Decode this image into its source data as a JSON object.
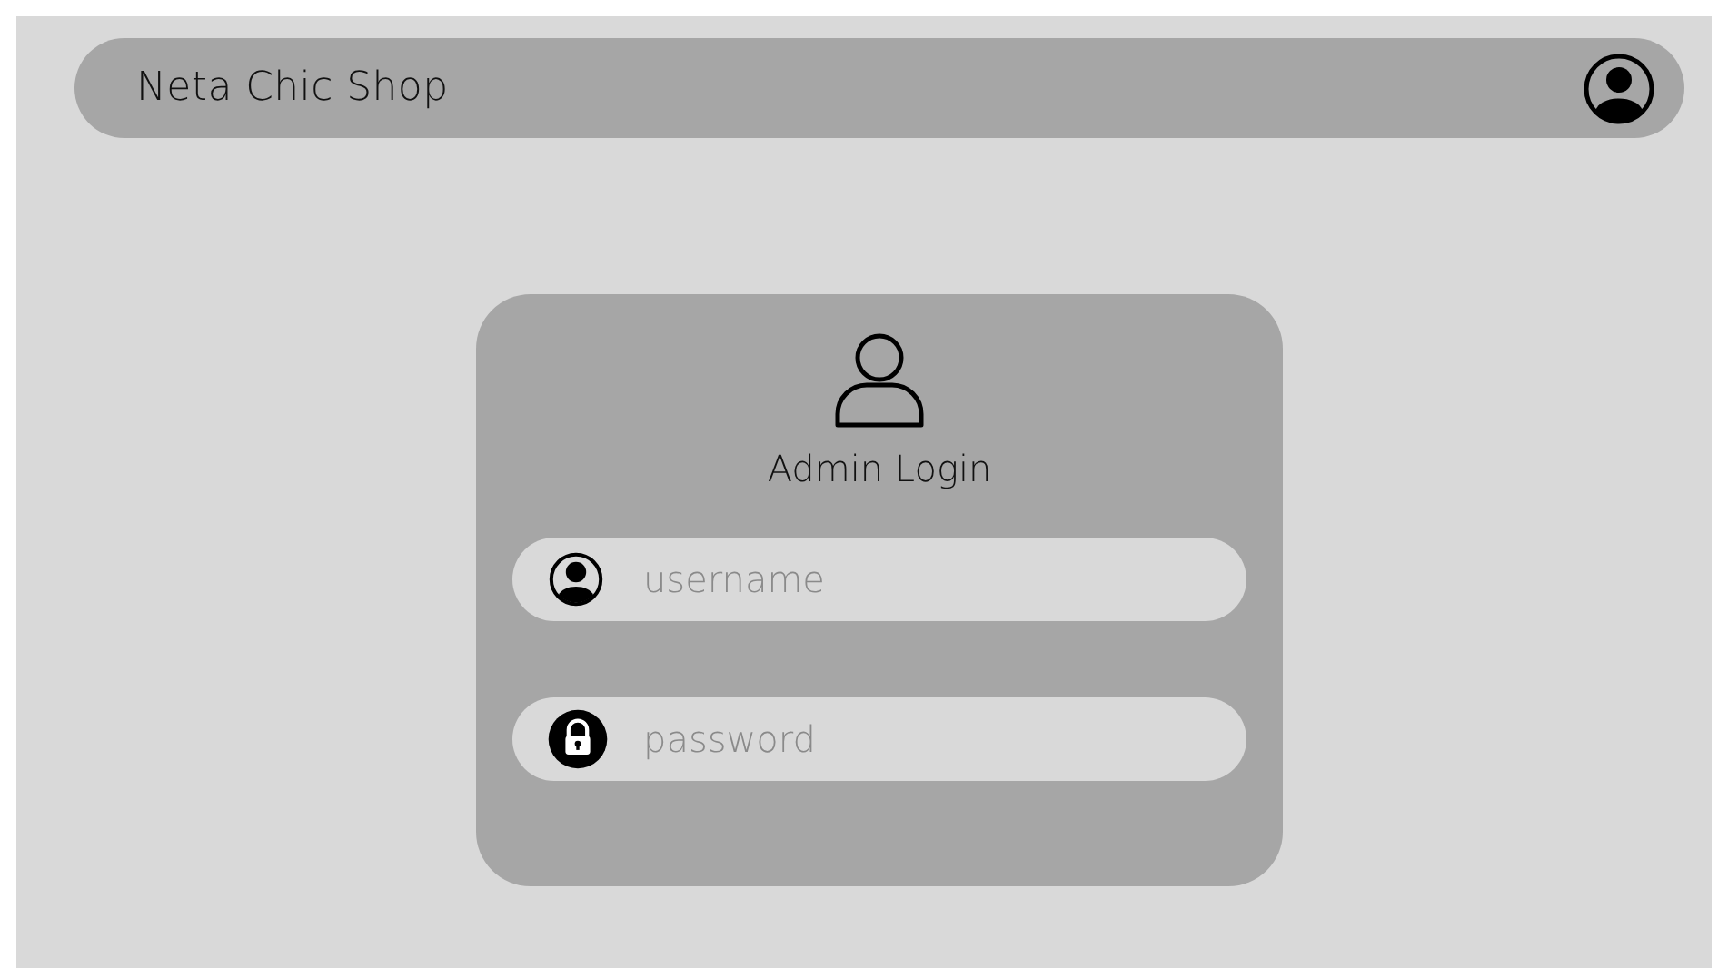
{
  "header": {
    "title": "Neta Chic Shop"
  },
  "login": {
    "title": "Admin Login",
    "fields": [
      {
        "kind": "username",
        "placeholder": "username"
      },
      {
        "kind": "password",
        "placeholder": "password"
      }
    ]
  }
}
